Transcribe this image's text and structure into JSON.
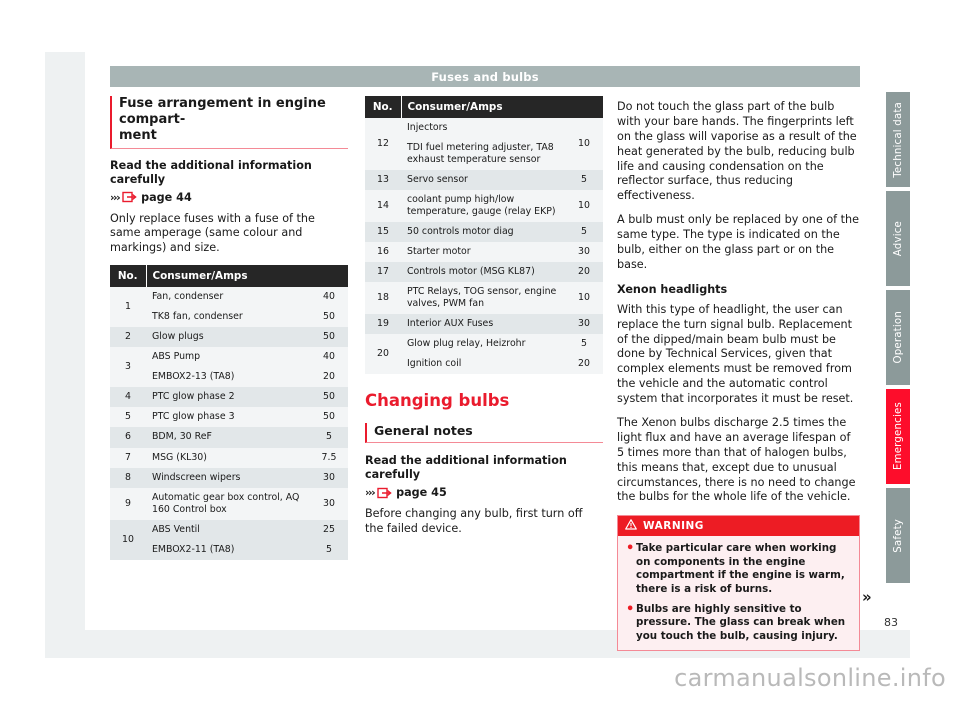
{
  "runhead": {
    "title": "Fuses and bulbs"
  },
  "page_number": "83",
  "continuation_marker": "»",
  "watermark": "carmanualsonline.info",
  "left_column": {
    "heading": "Fuse arrangement in engine compart-\nment",
    "read_carefully_label": "Read the additional information carefully",
    "xref_chevrons": "›››",
    "xref_page": "page 44",
    "xref_icon": "page-reference-icon",
    "intro_paragraph": "Only replace fuses with a fuse of the same amperage (same colour and markings) and size.",
    "table": {
      "headers": {
        "no": "No.",
        "consumer": "Consumer/Amps"
      },
      "rows": [
        {
          "no": "1",
          "items": [
            {
              "consumer": "Fan, condenser",
              "amps": "40"
            },
            {
              "consumer": "TK8 fan, condenser",
              "amps": "50"
            }
          ]
        },
        {
          "no": "2",
          "items": [
            {
              "consumer": "Glow plugs",
              "amps": "50"
            }
          ]
        },
        {
          "no": "3",
          "items": [
            {
              "consumer": "ABS Pump",
              "amps": "40"
            },
            {
              "consumer": "EMBOX2-13 (TA8)",
              "amps": "20"
            }
          ]
        },
        {
          "no": "4",
          "items": [
            {
              "consumer": "PTC glow phase 2",
              "amps": "50"
            }
          ]
        },
        {
          "no": "5",
          "items": [
            {
              "consumer": "PTC glow phase 3",
              "amps": "50"
            }
          ]
        },
        {
          "no": "6",
          "items": [
            {
              "consumer": "BDM, 30 ReF",
              "amps": "5"
            }
          ]
        },
        {
          "no": "7",
          "items": [
            {
              "consumer": "MSG (KL30)",
              "amps": "7.5"
            }
          ]
        },
        {
          "no": "8",
          "items": [
            {
              "consumer": "Windscreen wipers",
              "amps": "30"
            }
          ]
        },
        {
          "no": "9",
          "items": [
            {
              "consumer": "Automatic gear box control, AQ 160 Control box",
              "amps": "30"
            }
          ]
        },
        {
          "no": "10",
          "items": [
            {
              "consumer": "ABS Ventil",
              "amps": "25"
            },
            {
              "consumer": "EMBOX2-11 (TA8)",
              "amps": "5"
            }
          ]
        }
      ]
    }
  },
  "middle_column": {
    "table": {
      "headers": {
        "no": "No.",
        "consumer": "Consumer/Amps"
      },
      "rows": [
        {
          "no": "12",
          "items": [
            {
              "consumer": "Injectors",
              "amps": ""
            },
            {
              "consumer": "TDI fuel metering adjuster, TA8 exhaust temperature sensor",
              "amps": "10"
            }
          ],
          "merged_amps": "10"
        },
        {
          "no": "13",
          "items": [
            {
              "consumer": "Servo sensor",
              "amps": "5"
            }
          ]
        },
        {
          "no": "14",
          "items": [
            {
              "consumer": "coolant pump high/low temperature, gauge (relay EKP)",
              "amps": "10"
            }
          ]
        },
        {
          "no": "15",
          "items": [
            {
              "consumer": "50 controls motor diag",
              "amps": "5"
            }
          ]
        },
        {
          "no": "16",
          "items": [
            {
              "consumer": "Starter motor",
              "amps": "30"
            }
          ]
        },
        {
          "no": "17",
          "items": [
            {
              "consumer": "Controls motor (MSG KL87)",
              "amps": "20"
            }
          ]
        },
        {
          "no": "18",
          "items": [
            {
              "consumer": "PTC Relays, TOG sensor, engine valves, PWM fan",
              "amps": "10"
            }
          ]
        },
        {
          "no": "19",
          "items": [
            {
              "consumer": "Interior AUX Fuses",
              "amps": "30"
            }
          ]
        },
        {
          "no": "20",
          "items": [
            {
              "consumer": "Glow plug relay, Heizrohr",
              "amps": "5"
            },
            {
              "consumer": "Ignition coil",
              "amps": "20"
            }
          ]
        }
      ]
    },
    "section_title": "Changing bulbs",
    "subsection_title": "General notes",
    "read_carefully_label": "Read the additional information carefully",
    "xref_chevrons": "›››",
    "xref_page": "page 45",
    "xref_icon": "page-reference-icon",
    "body_paragraph": "Before changing any bulb, first turn off the failed device."
  },
  "right_column": {
    "paragraph_1": "Do not touch the glass part of the bulb with your bare hands. The fingerprints left on the glass will vaporise as a result of the heat generated by the bulb, reducing bulb life and causing condensation on the reflector surface, thus reducing effectiveness.",
    "paragraph_2": "A bulb must only be replaced by one of the same type. The type is indicated on the bulb, either on the glass part or on the base.",
    "subheading": "Xenon headlights",
    "paragraph_3": "With this type of headlight, the user can replace the turn signal bulb. Replacement of the dipped/main beam bulb must be done by Technical Services, given that complex elements must be removed from the vehicle and the automatic control system that incorporates it must be reset.",
    "paragraph_4": "The Xenon bulbs discharge 2.5 times the light flux and have an average lifespan of 5 times more than that of halogen bulbs, this means that, except due to unusual circumstances, there is no need to change the bulbs for the whole life of the vehicle.",
    "warning": {
      "label": "WARNING",
      "icon": "warning-triangle-icon",
      "bullets": [
        "Take particular care when working on components in the engine compartment if the engine is warm, there is a risk of burns.",
        "Bulbs are highly sensitive to pressure. The glass can break when you touch the bulb, causing injury."
      ]
    }
  },
  "section_tabs": [
    {
      "label": "Technical data",
      "active": false,
      "height": 95
    },
    {
      "label": "Advice",
      "active": false,
      "height": 95
    },
    {
      "label": "Operation",
      "active": false,
      "height": 95
    },
    {
      "label": "Emergencies",
      "active": true,
      "height": 95
    },
    {
      "label": "Safety",
      "active": false,
      "height": 95
    }
  ],
  "colors": {
    "accent_red": "#ea1b2d",
    "warning_red": "#ed1c24",
    "tab_active": "#fd0d2b",
    "tab_inactive": "#8c9a9a",
    "runhead_bg": "#a8b5b5",
    "table_header_bg": "#262626",
    "row_light": "#f3f5f6",
    "row_dark": "#e2e7e9",
    "mat_bg": "#eef1f2"
  }
}
